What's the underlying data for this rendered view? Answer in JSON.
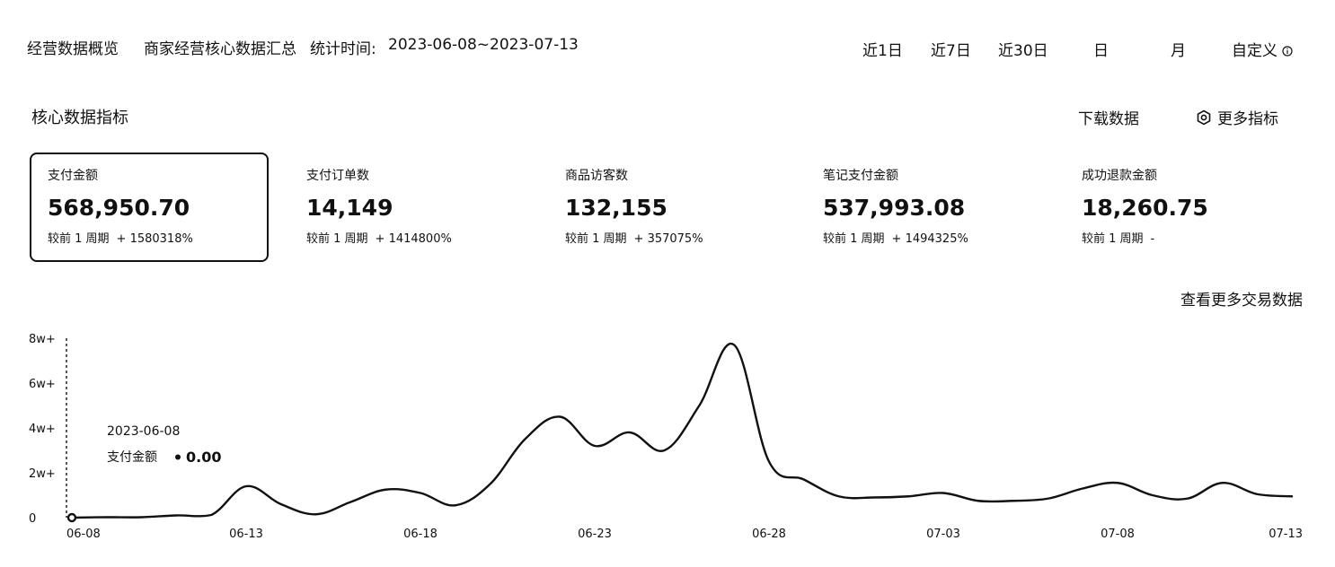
{
  "header": {
    "title": "经营数据概览",
    "subtitle": "商家经营核心数据汇总",
    "stat_time_label": "统计时间:",
    "stat_time_range": "2023-06-08~2023-07-13"
  },
  "periods": [
    {
      "label": "近1日"
    },
    {
      "label": "近7日"
    },
    {
      "label": "近30日"
    },
    {
      "label": "日"
    },
    {
      "label": "月"
    },
    {
      "label": "自定义"
    }
  ],
  "section": {
    "title": "核心数据指标",
    "download_label": "下载数据",
    "more_metrics_label": "更多指标"
  },
  "cards": [
    {
      "label": "支付金额",
      "value": "568,950.70",
      "compare_label": "较前 1 周期",
      "change": "+ 1580318%"
    },
    {
      "label": "支付订单数",
      "value": "14,149",
      "compare_label": "较前 1 周期",
      "change": "+ 1414800%"
    },
    {
      "label": "商品访客数",
      "value": "132,155",
      "compare_label": "较前 1 周期",
      "change": "+ 357075%"
    },
    {
      "label": "笔记支付金额",
      "value": "537,993.08",
      "compare_label": "较前 1 周期",
      "change": "+ 1494325%"
    },
    {
      "label": "成功退款金额",
      "value": "18,260.75",
      "compare_label": "较前 1 周期",
      "change": "-"
    }
  ],
  "more_trade_link": "查看更多交易数据",
  "colors": {
    "line": "#111111",
    "border": "#111111",
    "text": "#111111"
  },
  "chart_data": {
    "type": "line",
    "series": [
      {
        "name": "支付金额",
        "x": [
          "06-08",
          "06-09",
          "06-10",
          "06-11",
          "06-12",
          "06-13",
          "06-14",
          "06-15",
          "06-16",
          "06-17",
          "06-18",
          "06-19",
          "06-20",
          "06-21",
          "06-22",
          "06-23",
          "06-24",
          "06-25",
          "06-26",
          "06-27",
          "06-28",
          "06-29",
          "06-30",
          "07-01",
          "07-02",
          "07-03",
          "07-04",
          "07-05",
          "07-06",
          "07-07",
          "07-08",
          "07-09",
          "07-10",
          "07-11",
          "07-12",
          "07-13"
        ],
        "values": [
          0,
          200,
          200,
          1000,
          1200,
          14000,
          6000,
          1500,
          7000,
          12500,
          11000,
          5500,
          15000,
          35000,
          45000,
          32000,
          38000,
          30000,
          50000,
          77000,
          25000,
          17000,
          9500,
          9000,
          9500,
          11000,
          7500,
          7500,
          8500,
          13000,
          15500,
          10000,
          8500,
          15500,
          10500,
          9500
        ]
      }
    ],
    "x_tick_labels": [
      "06-08",
      "06-13",
      "06-18",
      "06-23",
      "06-28",
      "07-03",
      "07-08",
      "07-13"
    ],
    "y_ticks": [
      {
        "value": 0,
        "label": "0"
      },
      {
        "value": 20000,
        "label": "2w+"
      },
      {
        "value": 40000,
        "label": "4w+"
      },
      {
        "value": 60000,
        "label": "6w+"
      },
      {
        "value": 80000,
        "label": "8w+"
      }
    ],
    "ylim": [
      0,
      80000
    ],
    "grid": false,
    "tooltip": {
      "date": "2023-06-08",
      "label": "支付金额",
      "value": "0.00"
    }
  }
}
